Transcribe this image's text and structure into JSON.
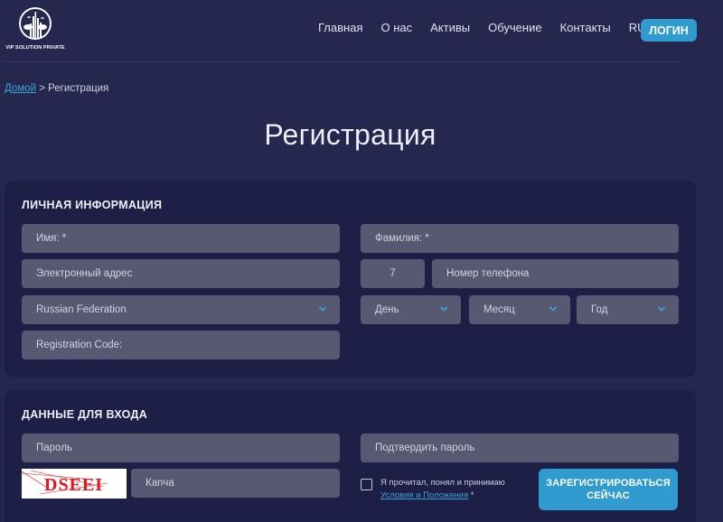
{
  "header": {
    "logo_text": "VIP SOLUTION PRIVATE",
    "nav": [
      "Главная",
      "О нас",
      "Активы",
      "Обучение",
      "Контакты"
    ],
    "language": "RU",
    "login_label": "ЛОГИН"
  },
  "breadcrumb": {
    "home": "Домой",
    "separator": " > ",
    "current": "Регистрация"
  },
  "page_title": "Регистрация",
  "personal": {
    "title": "ЛИЧНАЯ ИНФОРМАЦИЯ",
    "first_name_placeholder": "Имя: *",
    "last_name_placeholder": "Фамилия: *",
    "email_placeholder": "Электронный адрес",
    "phone_code_value": "7",
    "phone_placeholder": "Номер телефона",
    "country_value": "Russian Federation",
    "day_placeholder": "День",
    "month_placeholder": "Месяц",
    "year_placeholder": "Год",
    "registration_code_placeholder": "Registration Code:"
  },
  "login_data": {
    "title": "ДАННЫЕ ДЛЯ ВХОДА",
    "password_placeholder": "Пароль",
    "confirm_password_placeholder": "Подтвердить пароль",
    "captcha_text": "DSEEI",
    "captcha_placeholder": "Капча",
    "terms_text": "Я прочитал, понял и принимаю",
    "terms_link": "Условия и Положения",
    "terms_required": " *",
    "register_label_line1": "ЗАРЕГИСТРИРОВАТЬСЯ",
    "register_label_line2": "СЕЙЧАС"
  },
  "colors": {
    "page_bg": "#25274f",
    "card_bg": "#1e1f47",
    "input_bg": "#575973",
    "accent": "#2f9bcf",
    "captcha_text": "#e8141c"
  }
}
